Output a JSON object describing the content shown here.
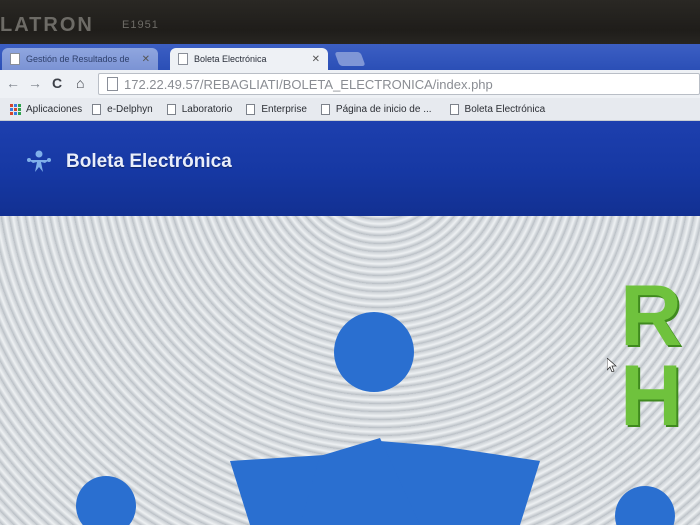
{
  "monitor": {
    "brand": "LATRON",
    "model": "E1951"
  },
  "browser": {
    "tabs": [
      {
        "title": "Gestión de Resultados de",
        "active": false
      },
      {
        "title": "Boleta Electrónica",
        "active": true
      }
    ],
    "url": "172.22.49.57/REBAGLIATI/BOLETA_ELECTRONICA/index.php",
    "bookmarks": [
      {
        "label": "Aplicaciones",
        "icon": "apps-icon"
      },
      {
        "label": "e-Delphyn",
        "icon": "doc-icon"
      },
      {
        "label": "Laboratorio",
        "icon": "doc-icon"
      },
      {
        "label": "Enterprise",
        "icon": "doc-icon"
      },
      {
        "label": "Página de inicio de ...",
        "icon": "doc-icon"
      },
      {
        "label": "Boleta Electrónica",
        "icon": "doc-icon"
      }
    ]
  },
  "page": {
    "header_title": "Boleta Electrónica",
    "hero_letters": [
      "R",
      "H"
    ]
  },
  "colors": {
    "header_blue": "#1a3aa8",
    "logo_blue": "#2a6fd0",
    "logo_green": "#6fc23d"
  }
}
